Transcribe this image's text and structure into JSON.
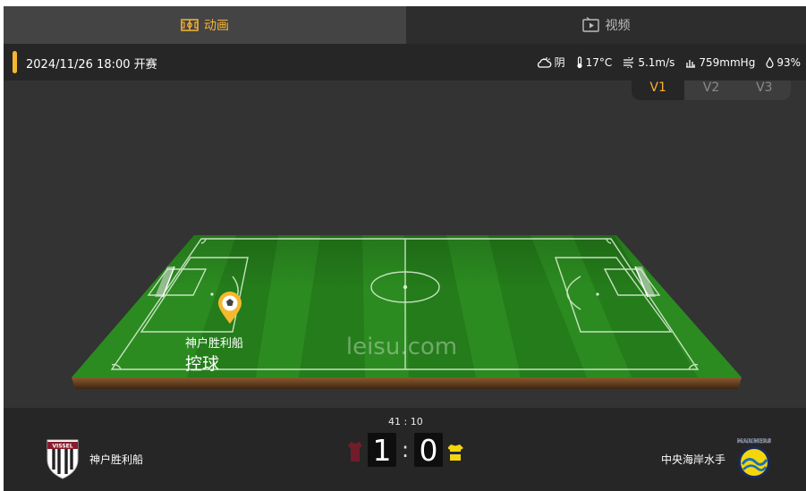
{
  "tabs": [
    {
      "label": "动画",
      "icon": "pitch-icon",
      "active": true
    },
    {
      "label": "视频",
      "icon": "video-play-icon",
      "active": false
    }
  ],
  "match": {
    "kickoff": "2024/11/26 18:00 开赛",
    "weather": {
      "condition": "阴",
      "temperature": "17°C",
      "wind": "5.1m/s",
      "pressure": "759mmHg",
      "humidity": "93%"
    }
  },
  "view_tabs": [
    "V1",
    "V2",
    "V3"
  ],
  "field": {
    "watermark": "leisu.com",
    "possession_team": "神户胜利船",
    "possession_label": "控球"
  },
  "score": {
    "time": "41 : 10",
    "home_score": "1",
    "away_score": "0",
    "separator": ":"
  },
  "teams": {
    "home": {
      "name": "神户胜利船",
      "logo_text": "VISSEL",
      "kit_color": "#8b1a2c"
    },
    "away": {
      "name": "中央海岸水手",
      "logo_text": "MARINERS",
      "kit_color": "#f4d60a"
    }
  },
  "colors": {
    "accent": "#f6b332",
    "pitch": "#2a8a1e",
    "panel": "#262626"
  }
}
